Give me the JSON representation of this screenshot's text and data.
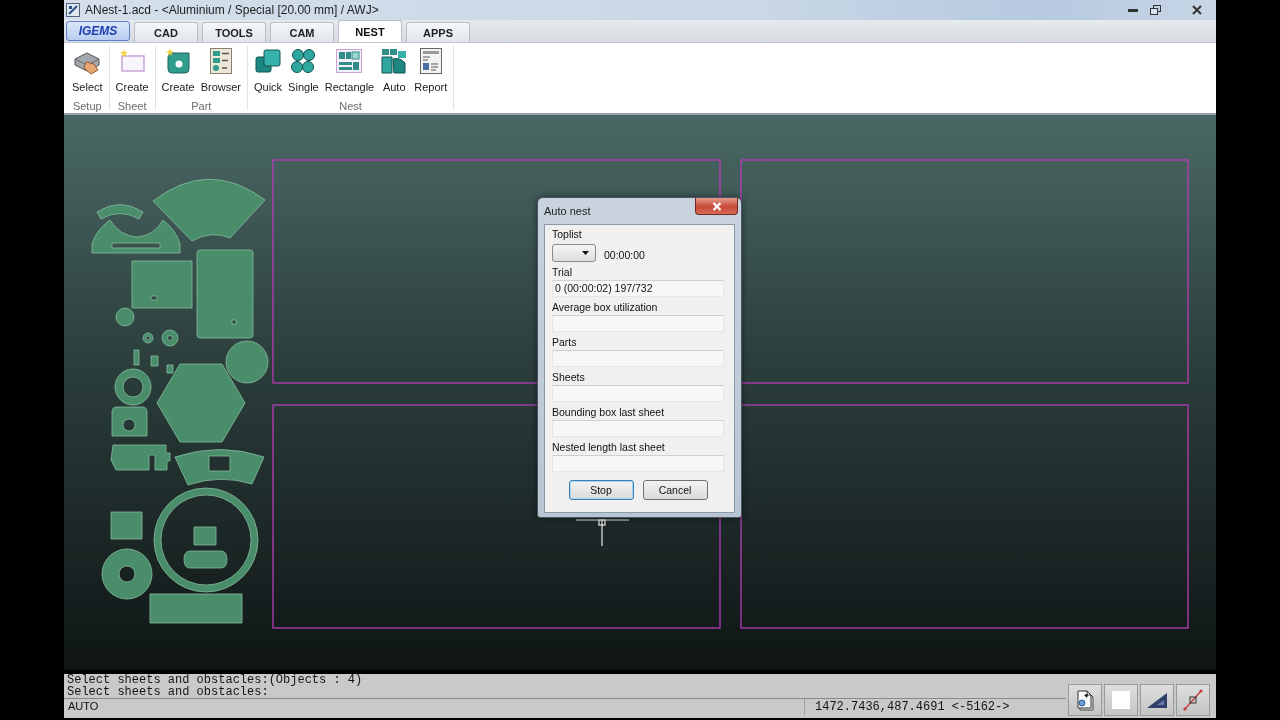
{
  "window": {
    "title": "ANest-1.acd - <Aluminium / Special [20.00 mm] / AWJ>"
  },
  "tabs": [
    {
      "label": "IGEMS",
      "kind": "app",
      "selected": false
    },
    {
      "label": "CAD",
      "kind": "tab",
      "selected": false
    },
    {
      "label": "TOOLS",
      "kind": "tab",
      "selected": false
    },
    {
      "label": "CAM",
      "kind": "tab",
      "selected": false
    },
    {
      "label": "NEST",
      "kind": "tab",
      "selected": true
    },
    {
      "label": "APPS",
      "kind": "tab",
      "selected": false
    }
  ],
  "ribbon": {
    "groups": [
      {
        "label": "Setup",
        "buttons": [
          {
            "label": "Select"
          }
        ]
      },
      {
        "label": "Sheet",
        "buttons": [
          {
            "label": "Create"
          }
        ]
      },
      {
        "label": "Part",
        "buttons": [
          {
            "label": "Create"
          },
          {
            "label": "Browser"
          }
        ]
      },
      {
        "label": "Nest",
        "buttons": [
          {
            "label": "Quick"
          },
          {
            "label": "Single"
          },
          {
            "label": "Rectangle"
          },
          {
            "label": "Auto"
          },
          {
            "label": "Report"
          }
        ]
      }
    ]
  },
  "dialog": {
    "title": "Auto nest",
    "toplist": {
      "label": "Toplist",
      "time": "00:00:00"
    },
    "fields": [
      {
        "label": "Trial",
        "value": "0 (00:00:02) 197/732"
      },
      {
        "label": "Average box utilization"
      },
      {
        "label": "Parts"
      },
      {
        "label": "Sheets"
      },
      {
        "label": "Bounding box last sheet"
      },
      {
        "label": "Nested length last sheet"
      }
    ],
    "buttons": [
      {
        "label": "Stop",
        "focused": true
      },
      {
        "label": "Cancel",
        "focused": false
      }
    ]
  },
  "command_line": {
    "history": [
      "Select sheets and obstacles:(Objects : 4)",
      "Select sheets and obstacles:"
    ],
    "input": "AUTO"
  },
  "status_bar": {
    "coordinates": "1472.7436,487.4691 <-5162->"
  }
}
